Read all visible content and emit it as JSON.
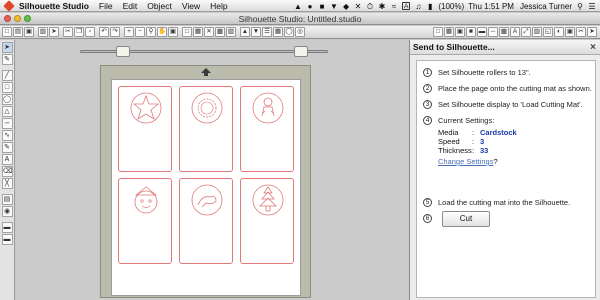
{
  "menubar": {
    "app_name": "Silhouette Studio",
    "items": [
      "File",
      "Edit",
      "Object",
      "View",
      "Help"
    ],
    "tray": {
      "battery": "(100%)",
      "clock": "Thu 1:51 PM",
      "user": "Jessica Turner"
    }
  },
  "window": {
    "title": "Silhouette Studio: Untitled.studio"
  },
  "panel": {
    "title": "Send to Silhouette...",
    "close": "×",
    "steps": [
      {
        "num": "1",
        "text": "Set Silhouette rollers to 13\"."
      },
      {
        "num": "2",
        "text": "Place the page onto the cutting mat as shown."
      },
      {
        "num": "3",
        "text": "Set Silhouette display to 'Load Cutting Mat'."
      },
      {
        "num": "4",
        "text": "Current Settings:"
      },
      {
        "num": "5",
        "text": "Load the cutting mat into the Silhouette."
      },
      {
        "num": "6",
        "text": ""
      }
    ],
    "settings": {
      "media_label": "Media",
      "media_value": "Cardstock",
      "speed_label": "Speed",
      "speed_value": "3",
      "thickness_label": "Thickness",
      "thickness_value": "33",
      "separator": ":"
    },
    "change_settings": "Change Settings",
    "change_settings_suffix": "?",
    "cut_button": "Cut"
  },
  "colors": {
    "cut_line": "#e07878",
    "setting_value": "#1a3aa8",
    "link": "#4a6fb5"
  }
}
